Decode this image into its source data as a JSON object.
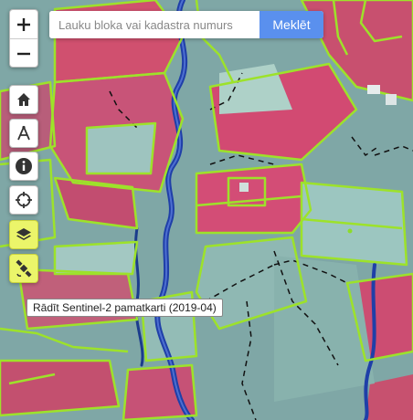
{
  "search": {
    "placeholder": "Lauku bloka vai kadastra numurs",
    "button_label": "Meklēt"
  },
  "zoom": {
    "in_icon": "plus-icon",
    "out_icon": "minus-icon"
  },
  "tools": [
    {
      "icon": "home-icon",
      "active": false
    },
    {
      "icon": "measure-compass-icon",
      "active": false
    },
    {
      "icon": "info-icon",
      "active": false
    },
    {
      "icon": "locate-crosshair-icon",
      "active": false
    },
    {
      "icon": "layers-icon",
      "active": true
    },
    {
      "icon": "satellite-icon",
      "active": true
    }
  ],
  "tooltip": {
    "text": "Rādīt Sentinel-2 pamatkarti (2019-04)"
  },
  "colors": {
    "parcel_outline": "#9de22a",
    "river": "#1f3fa8",
    "field_red": "#d24a72",
    "field_teal": "#8fb8b3",
    "accent_button": "#5a90ee",
    "active_tool": "#ebf56a"
  }
}
